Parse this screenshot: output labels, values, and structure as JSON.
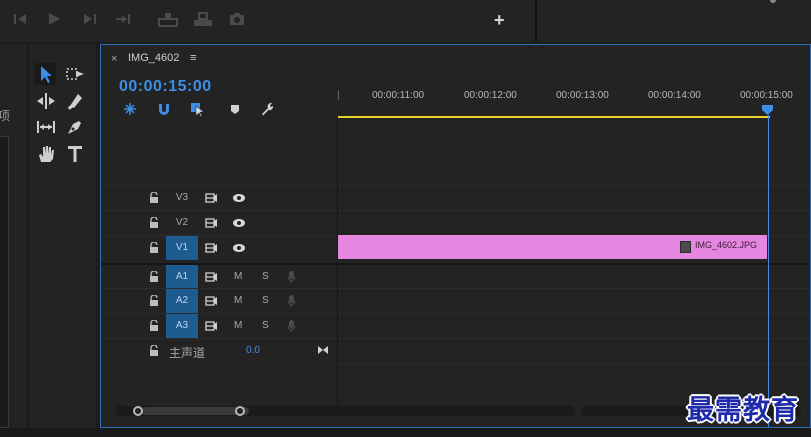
{
  "left_panel": {
    "label": "项"
  },
  "timeline": {
    "close_glyph": "×",
    "sequence_name": "IMG_4602",
    "menu_glyph": "≡",
    "timecode": "00:00:15:00",
    "ruler_start_glyph": "|",
    "ruler_ticks": [
      "00:00:11:00",
      "00:00:12:00",
      "00:00:13:00",
      "00:00:14:00",
      "00:00:15:00"
    ]
  },
  "tracks": {
    "video": [
      {
        "name": "V3",
        "active": false
      },
      {
        "name": "V2",
        "active": false
      },
      {
        "name": "V1",
        "active": true
      }
    ],
    "audio": [
      {
        "name": "A1",
        "active": true,
        "mute": "M",
        "solo": "S"
      },
      {
        "name": "A2",
        "active": true,
        "mute": "M",
        "solo": "S"
      },
      {
        "name": "A3",
        "active": true,
        "mute": "M",
        "solo": "S"
      }
    ],
    "master": {
      "label": "主声道",
      "value": "0.0"
    }
  },
  "clip": {
    "name": "IMG_4602.JPG",
    "color": "#e586e0",
    "track": "V1"
  },
  "colors": {
    "accent": "#3d8ee6",
    "work_area": "#e8d22a",
    "track_active": "#1e5c90"
  },
  "watermark": {
    "text": "最需教育"
  }
}
